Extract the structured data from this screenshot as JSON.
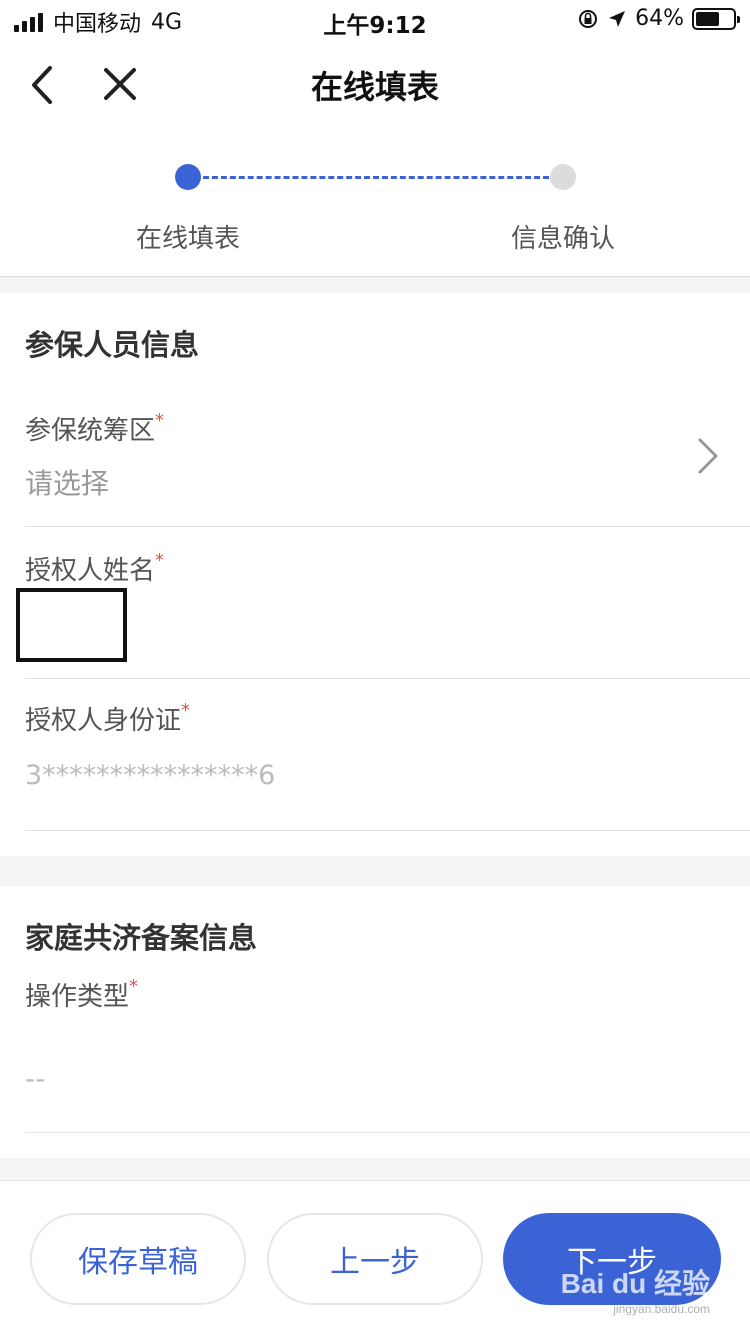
{
  "status_bar": {
    "carrier": "中国移动",
    "network": "4G",
    "time": "上午9:12",
    "battery": "64%",
    "battery_level": 0.64
  },
  "nav": {
    "title": "在线填表"
  },
  "steps": [
    {
      "label": "在线填表",
      "active": true
    },
    {
      "label": "信息确认",
      "active": false
    }
  ],
  "section_insured": {
    "title": "参保人员信息",
    "fields": [
      {
        "label": "参保统筹区",
        "value": "请选择"
      },
      {
        "label": "授权人姓名",
        "value": ""
      },
      {
        "label": "授权人身份证",
        "value": "3****************6"
      }
    ]
  },
  "section_family": {
    "title": "家庭共济备案信息",
    "fields": [
      {
        "label": "操作类型",
        "value": "--"
      }
    ]
  },
  "required_mark": "*",
  "buttons": {
    "save_draft": "保存草稿",
    "prev": "上一步",
    "next": "下一步"
  },
  "watermark": {
    "text": "Bai du 经验",
    "sub": "jingyan.baidu.com"
  },
  "colors": {
    "accent": "#3b63d6",
    "required": "#d9534f"
  }
}
